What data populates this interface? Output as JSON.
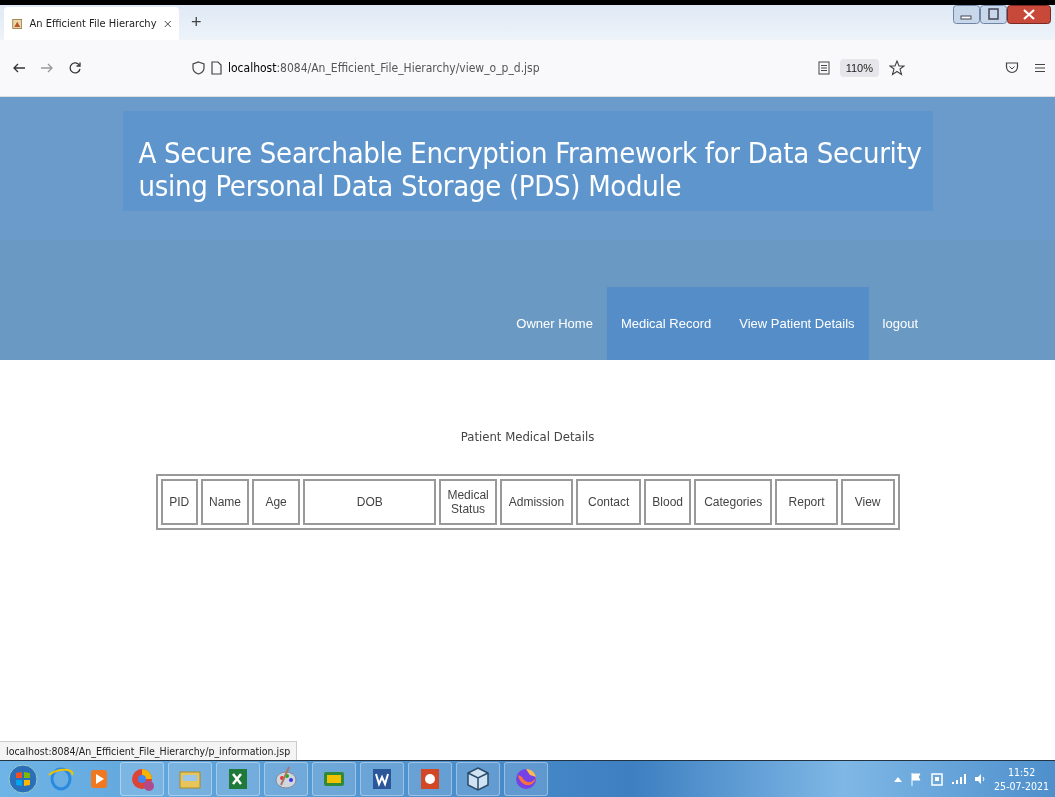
{
  "browser": {
    "tab_title": "An Efficient File Hierarchy",
    "new_tab": "+",
    "url_host": "localhost",
    "url_path": ":8084/An_Efficient_File_Hierarchy/view_o_p_d.jsp",
    "zoom": "110%"
  },
  "header": {
    "title": "A Secure Searchable Encryption Framework for Data Security using Personal Data Storage (PDS) Module"
  },
  "nav": [
    {
      "label": "Owner Home",
      "selected": false
    },
    {
      "label": "Medical Record",
      "selected": true
    },
    {
      "label": "View Patient Details",
      "selected": true
    },
    {
      "label": "logout",
      "selected": false
    }
  ],
  "content": {
    "heading": "Patient Medical Details"
  },
  "table": {
    "columns": [
      "PID",
      "Name",
      "Age",
      "DOB",
      "Medical Status",
      "Admission",
      "Contact",
      "Blood",
      "Categories",
      "Report",
      "View"
    ]
  },
  "status_bar": {
    "link": "localhost:8084/An_Efficient_File_Hierarchy/p_information.jsp"
  },
  "taskbar": {
    "time": "11:52",
    "date": "25-07-2021"
  }
}
